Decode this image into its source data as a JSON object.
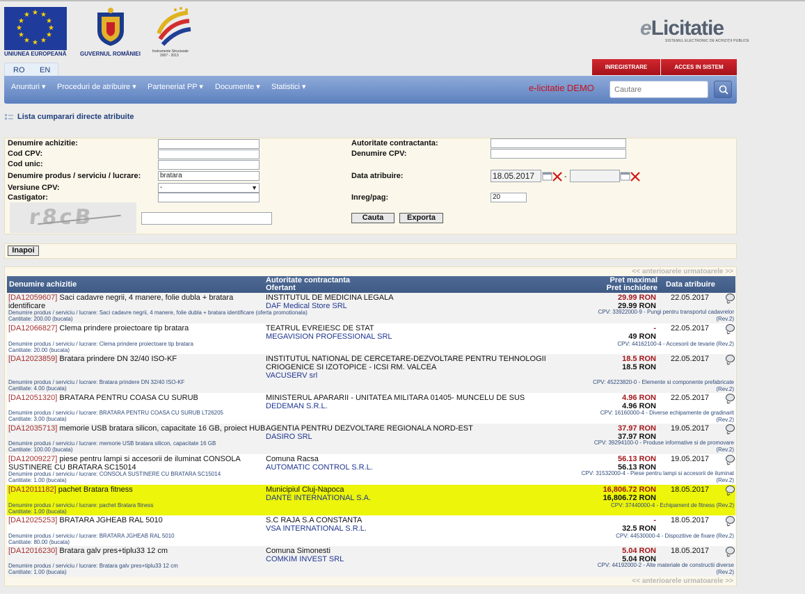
{
  "header": {
    "eu_caption": "UNIUNEA EUROPEANĂ",
    "gov_caption": "GUVERNUL ROMÂNIEI",
    "is_caption_1": "Instrumente Structurale",
    "is_caption_2": "2007 - 2013",
    "brand_e": "e",
    "brand_name": "Licitatie",
    "brand_sub": "SISTEMUL ELECTRONIC DE ACHIZIȚII PUBLICE",
    "lang_ro": "RO",
    "lang_en": "EN",
    "register_label": "Inregistrare",
    "login_label": "Acces in sistem"
  },
  "nav": {
    "items": [
      "Anunturi ▾",
      "Proceduri de atribuire ▾",
      "Parteneriat PP ▾",
      "Documente ▾",
      "Statistici ▾"
    ],
    "demo_label": "e-licitatie DEMO",
    "search_placeholder": "Cautare"
  },
  "breadcrumb": "Lista cumparari directe atribuite",
  "form": {
    "labels": {
      "denumire": "Denumire achizitie:",
      "cod_cpv": "Cod CPV:",
      "cod_unic": "Cod unic:",
      "produs": "Denumire produs / serviciu / lucrare:",
      "versiune": "Versiune CPV:",
      "castigator": "Castigator:",
      "autoritate": "Autoritate contractanta:",
      "den_cpv": "Denumire CPV:",
      "data": "Data atribuire:",
      "inreg": "Inreg/pag:"
    },
    "values": {
      "produs": "bratara",
      "versiune": "-",
      "data_from": "18.05.2017",
      "inreg": "20"
    },
    "captcha_text": "r8cB",
    "search_button": "Cauta",
    "export_button": "Exporta",
    "back_button": "Inapoi"
  },
  "results": {
    "pager": "<< anterioarele urmatoarele >>",
    "headers": {
      "col1": "Denumire achizitie",
      "col2a": "Autoritate contractanta",
      "col2b": "Ofertant",
      "col3a": "Pret maximal",
      "col3b": "Pret inchidere",
      "col4": "Data atribuire"
    },
    "rows": [
      {
        "code": "[DA12059607]",
        "title": " Saci cadavre negrii, 4 manere, folie dubla + bratara identificare",
        "detail": "Denumire produs / serviciu / lucrare: Saci cadavre negrii, 4 manere, folie dubla + bratara identificare (oferta promotionala)",
        "qty": "Cantitate: 200.00 (bucata)",
        "authority": "INSTITUTUL DE MEDICINA LEGALA",
        "bidder": "DAF Medical Store SRL",
        "pmax": "29.99 RON",
        "pmin": "29.99  RON",
        "date": "22.05.2017",
        "cpv": "CPV: 33922000-9 - Pungi pentru transportul cadavrelor (Rev.2)"
      },
      {
        "code": "[DA12066827]",
        "title": " Clema prindere proiectoare tip bratara",
        "detail": "Denumire produs / serviciu / lucrare: Clema prindere proiectoare tip bratara",
        "qty": "Cantitate: 20.00 (bucata)",
        "authority": "TEATRUL EVREIESC DE STAT",
        "bidder": "MEGAVISION PROFESSIONAL SRL",
        "pmax": "-",
        "pmin": "49  RON",
        "date": "22.05.2017",
        "cpv": "CPV: 44162100-4 - Accesorii de tevarie (Rev.2)"
      },
      {
        "code": "[DA12023859]",
        "title": " Bratara prindere DN 32/40 ISO-KF",
        "detail": "Denumire produs / serviciu / lucrare: Bratara prindere DN 32/40 ISO-KF",
        "qty": "Cantitate: 4.00 (bucata)",
        "authority": "INSTITUTUL NATIONAL DE CERCETARE-DEZVOLTARE PENTRU TEHNOLOGII CRIOGENICE SI IZOTOPICE - ICSI RM. VALCEA",
        "bidder": "VACUSERV srl",
        "pmax": "18.5 RON",
        "pmin": "18.5  RON",
        "date": "22.05.2017",
        "cpv": "CPV: 45223820-0 - Elemente si componente prefabricate (Rev.2)"
      },
      {
        "code": "[DA12051320]",
        "title": " BRATARA PENTRU COASA CU SURUB",
        "detail": "Denumire produs / serviciu / lucrare: BRATARA PENTRU COASA CU SURUB LT26205",
        "qty": "Cantitate: 3.00 (bucata)",
        "authority": "MINISTERUL APARARII - UNITATEA MILITARA 01405- MUNCELU DE SUS",
        "bidder": "DEDEMAN S.R.L.",
        "pmax": "4.96 RON",
        "pmin": "4.96  RON",
        "date": "22.05.2017",
        "cpv": "CPV: 16160000-4 - Diverse echipamente de gradinarit (Rev.2)"
      },
      {
        "code": "[DA12035713]",
        "title": " memorie USB bratara silicon, capacitate 16 GB, proiect HUB",
        "detail": "Denumire produs / serviciu / lucrare: memorie USB bratara silicon, capacitate 16 GB",
        "qty": "Cantitate: 100.00 (bucata)",
        "authority": "AGENTIA PENTRU DEZVOLTARE REGIONALA NORD-EST",
        "bidder": "DASIRO SRL",
        "pmax": "37.97 RON",
        "pmin": "37.97  RON",
        "date": "19.05.2017",
        "cpv": "CPV: 39294100-0 - Produse informative si de promovare (Rev.2)"
      },
      {
        "code": "[DA12009227]",
        "title": " piese pentru lampi si accesorii de iluminat CONSOLA SUSTINERE CU BRATARA SC15014",
        "detail": "Denumire produs / serviciu / lucrare: CONSOLA SUSTINERE CU BRATARA SC15014",
        "qty": "Cantitate: 1.00 (bucata)",
        "authority": "Comuna Racsa",
        "bidder": "AUTOMATIC CONTROL S.R.L.",
        "pmax": "56.13 RON",
        "pmin": "56.13  RON",
        "date": "19.05.2017",
        "cpv": "CPV: 31532000-4 - Piese pentru lampi si accesorii de iluminat (Rev.2)"
      },
      {
        "code": "[DA12011182]",
        "title": " pachet Bratara fitness",
        "detail": "Denumire produs / serviciu / lucrare: pachet Bratara fitness",
        "qty": "Cantitate: 1.00 (bucata)",
        "authority": "Municipiul Cluj-Napoca",
        "bidder": "DANTE INTERNATIONAL S.A.",
        "pmax": "16,806.72 RON",
        "pmin": "16,806.72  RON",
        "date": "18.05.2017",
        "cpv": "CPV: 37440000-4 - Echipament de fitness (Rev.2)"
      },
      {
        "code": "[DA12025253]",
        "title": " BRATARA JGHEAB RAL 5010",
        "detail": "Denumire produs / serviciu / lucrare: BRATARA JGHEAB RAL 5010",
        "qty": "Cantitate: 80.00 (bucata)",
        "authority": "S.C RAJA S.A CONSTANTA",
        "bidder": "VSA INTERNATIONAL S.R.L.",
        "pmax": "-",
        "pmin": "32.5  RON",
        "date": "18.05.2017",
        "cpv": "CPV: 44530000-4 - Dispozitive de fixare (Rev.2)"
      },
      {
        "code": "[DA12016230]",
        "title": " Bratara galv pres+tiplu33 12 cm",
        "detail": "Denumire produs / serviciu / lucrare: Bratara galv pres+tiplu33 12 cm",
        "qty": "Cantitate: 1.00 (bucata)",
        "authority": "Comuna Simonesti",
        "bidder": "COMKIM INVEST SRL",
        "pmax": "5.04 RON",
        "pmin": "5.04  RON",
        "date": "18.05.2017",
        "cpv": "CPV: 44192000-2 - Alte materiale de constructii diverse (Rev.2)"
      }
    ]
  }
}
